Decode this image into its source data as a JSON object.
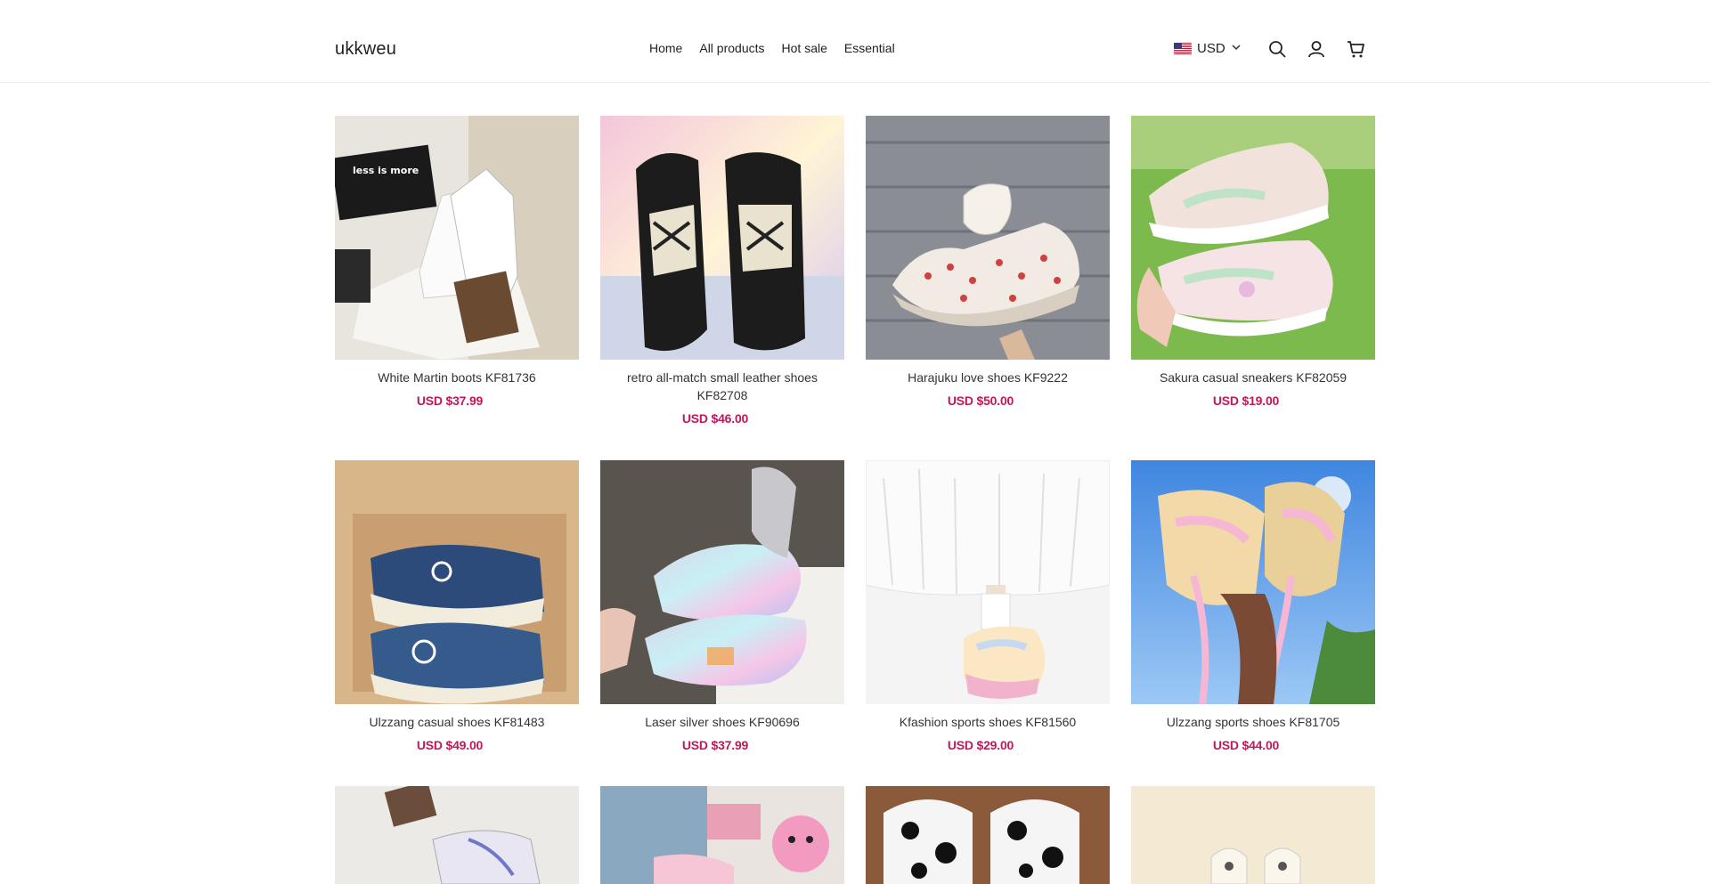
{
  "header": {
    "logo": "ukkweu",
    "nav": [
      "Home",
      "All products",
      "Hot sale",
      "Essential"
    ],
    "currency": "USD",
    "icons": [
      "us-flag-icon",
      "chevron-down-icon",
      "search-icon",
      "account-icon",
      "cart-icon"
    ]
  },
  "products": [
    {
      "name": "White Martin boots KF81736",
      "price": "USD $37.99"
    },
    {
      "name": "retro all-match small leather shoes KF82708",
      "price": "USD $46.00"
    },
    {
      "name": "Harajuku love shoes KF9222",
      "price": "USD $50.00"
    },
    {
      "name": "Sakura casual sneakers KF82059",
      "price": "USD $19.00"
    },
    {
      "name": "Ulzzang casual shoes KF81483",
      "price": "USD $49.00"
    },
    {
      "name": "Laser silver shoes KF90696",
      "price": "USD $37.99"
    },
    {
      "name": "Kfashion sports shoes KF81560",
      "price": "USD $29.00"
    },
    {
      "name": "Ulzzang sports shoes KF81705",
      "price": "USD $44.00"
    }
  ],
  "image_text": {
    "notebook": "less is more"
  },
  "colors": {
    "price": "#c2185b",
    "header_border": "#ececec"
  }
}
